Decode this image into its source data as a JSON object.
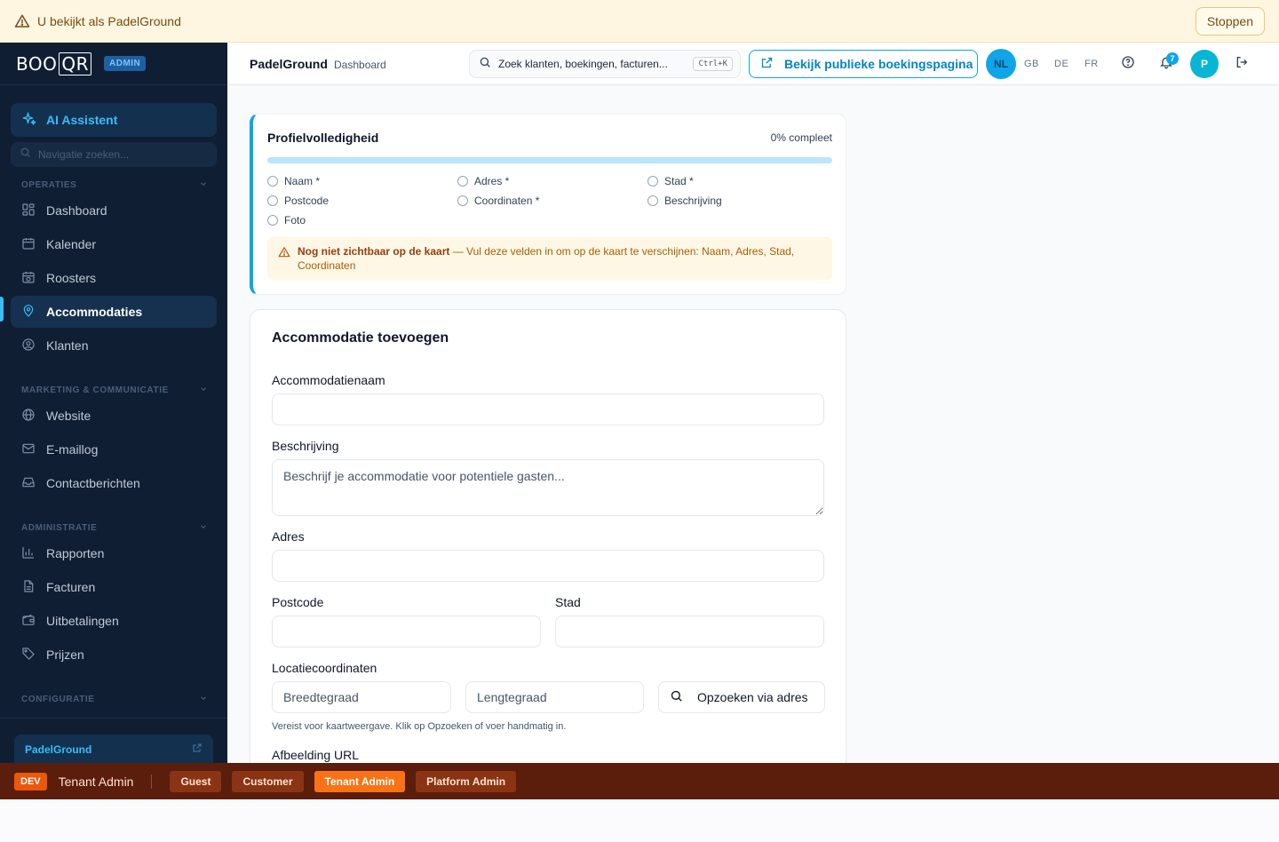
{
  "banner": {
    "message": "U bekijkt als PadelGround",
    "stop_label": "Stoppen"
  },
  "sidebar": {
    "logo_text": "BOO",
    "logo_qr": "QR",
    "admin_badge": "ADMIN",
    "ai_assistant": "AI Assistent",
    "nav_search_placeholder": "Navigatie zoeken...",
    "sections": [
      {
        "title": "OPERATIES",
        "items": [
          {
            "label": "Dashboard",
            "icon": "grid-icon"
          },
          {
            "label": "Kalender",
            "icon": "calendar-icon"
          },
          {
            "label": "Roosters",
            "icon": "schedule-icon"
          },
          {
            "label": "Accommodaties",
            "icon": "location-pin-icon",
            "active": true
          },
          {
            "label": "Klanten",
            "icon": "user-circle-icon"
          }
        ]
      },
      {
        "title": "MARKETING & COMMUNICATIE",
        "items": [
          {
            "label": "Website",
            "icon": "globe-icon"
          },
          {
            "label": "E-maillog",
            "icon": "mail-icon"
          },
          {
            "label": "Contactberichten",
            "icon": "inbox-icon"
          }
        ]
      },
      {
        "title": "ADMINISTRATIE",
        "items": [
          {
            "label": "Rapporten",
            "icon": "bar-chart-icon"
          },
          {
            "label": "Facturen",
            "icon": "document-icon"
          },
          {
            "label": "Uitbetalingen",
            "icon": "wallet-icon"
          },
          {
            "label": "Prijzen",
            "icon": "tag-icon"
          }
        ]
      },
      {
        "title": "CONFIGURATIE",
        "items": []
      }
    ],
    "tenant_link": "PadelGround"
  },
  "header": {
    "title": "PadelGround",
    "subtitle": "Dashboard",
    "search_placeholder": "Zoek klanten, boekingen, facturen...",
    "search_shortcut": "Ctrl+K",
    "public_button": "Bekijk publieke boekingspagina",
    "languages": [
      "NL",
      "GB",
      "DE",
      "FR"
    ],
    "active_language": "NL",
    "notification_count": "7",
    "avatar_initial": "P"
  },
  "profile": {
    "title": "Profielvolledigheid",
    "percent_label": "0% compleet",
    "percent": 0,
    "checklist": [
      {
        "label": "Naam *",
        "done": false
      },
      {
        "label": "Adres *",
        "done": false
      },
      {
        "label": "Stad *",
        "done": false
      },
      {
        "label": "Postcode",
        "done": false
      },
      {
        "label": "Coordinaten *",
        "done": false
      },
      {
        "label": "Beschrijving",
        "done": false
      },
      {
        "label": "Foto",
        "done": false
      }
    ],
    "warning_bold": "Nog niet zichtbaar op de kaart",
    "warning_text": " — Vul deze velden in om op de kaart te verschijnen: Naam, Adres, Stad, Coordinaten"
  },
  "form": {
    "title": "Accommodatie toevoegen",
    "name_label": "Accommodatienaam",
    "name_value": "",
    "description_label": "Beschrijving",
    "description_placeholder": "Beschrijf je accommodatie voor potentiele gasten...",
    "address_label": "Adres",
    "postcode_label": "Postcode",
    "city_label": "Stad",
    "coords_label": "Locatiecoordinaten",
    "lat_placeholder": "Breedtegraad",
    "lng_placeholder": "Lengtegraad",
    "lookup_button": "Opzoeken via adres",
    "coords_hint": "Vereist voor kaartweergave. Klik op Opzoeken of voer handmatig in.",
    "image_label": "Afbeelding URL"
  },
  "devbar": {
    "badge": "DEV",
    "current_role": "Tenant Admin",
    "roles": [
      "Guest",
      "Customer",
      "Tenant Admin",
      "Platform Admin"
    ],
    "active_role": "Tenant Admin"
  },
  "colors": {
    "accent": "#0ea5e9",
    "sidebar_bg": "#0f1e33",
    "devbar_bg": "#5b1d0c",
    "banner_bg": "#fef6e0"
  }
}
